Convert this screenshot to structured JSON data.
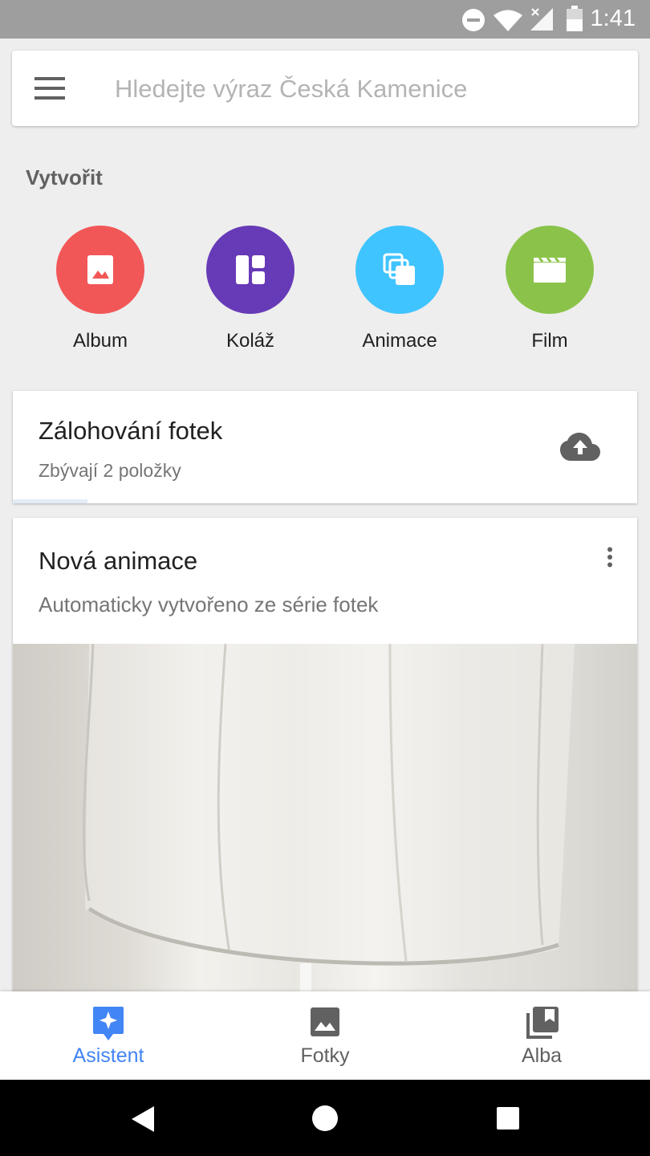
{
  "status_bar": {
    "time": "1:41",
    "icons": [
      "do-not-disturb-icon",
      "wifi-icon",
      "signal-icon",
      "battery-icon"
    ]
  },
  "search": {
    "placeholder": "Hledejte výraz Česká Kamenice",
    "menu_icon": "menu-icon"
  },
  "create": {
    "title": "Vytvořit",
    "items": [
      {
        "label": "Album",
        "icon": "album-icon",
        "color": "#f25757"
      },
      {
        "label": "Koláž",
        "icon": "collage-icon",
        "color": "#673ab7"
      },
      {
        "label": "Animace",
        "icon": "animation-icon",
        "color": "#40c4ff"
      },
      {
        "label": "Film",
        "icon": "movie-icon",
        "color": "#8bc34a"
      }
    ]
  },
  "backup_card": {
    "title": "Zálohování fotek",
    "subtitle": "Zbývají 2 položky",
    "icon": "cloud-upload-icon",
    "progress": 0.12
  },
  "animation_card": {
    "title": "Nová animace",
    "subtitle": "Automaticky vytvořeno ze série fotek",
    "menu_icon": "more-vert-icon"
  },
  "bottom_nav": {
    "active": "Asistent",
    "items": [
      {
        "label": "Asistent",
        "icon": "assistant-icon"
      },
      {
        "label": "Fotky",
        "icon": "photos-icon"
      },
      {
        "label": "Alba",
        "icon": "albums-icon"
      }
    ],
    "active_color": "#4285f4"
  },
  "system_nav": {
    "icons": [
      "back-icon",
      "home-icon",
      "recents-icon"
    ]
  }
}
